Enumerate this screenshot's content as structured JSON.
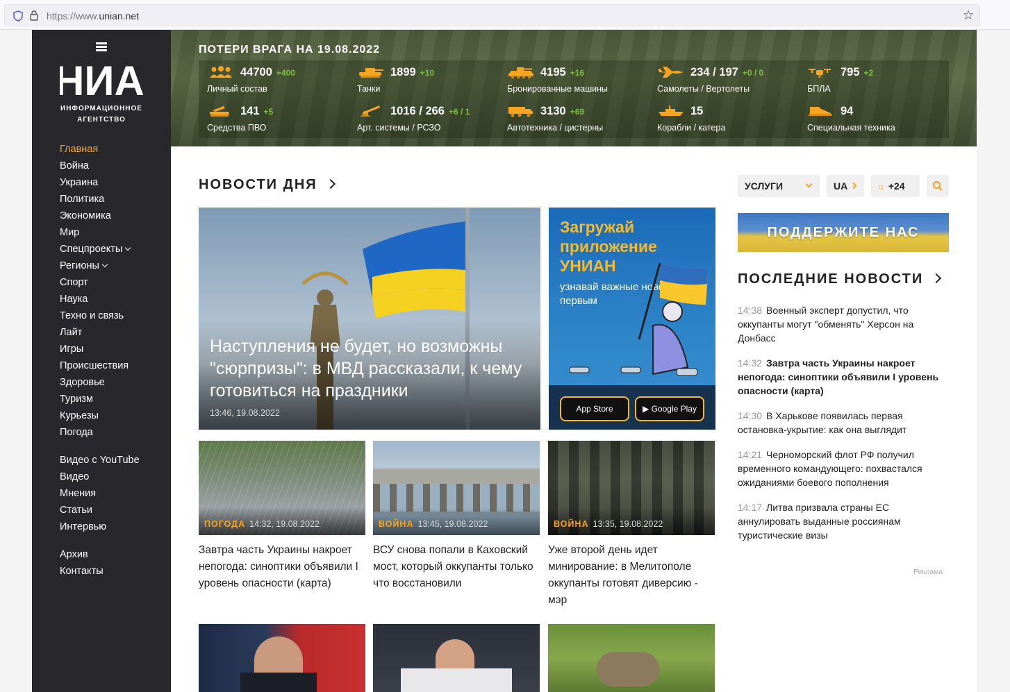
{
  "browser": {
    "url_prefix": "https://www.",
    "url_domain": "unian.net"
  },
  "logo": {
    "name": "УНИАН",
    "subtitle_1": "ИНФОРМАЦИОННОЕ",
    "subtitle_2": "АГЕНТСТВО"
  },
  "nav": {
    "main": [
      "Главная",
      "Война",
      "Украина",
      "Политика",
      "Экономика",
      "Мир",
      "Спецпроекты",
      "Регионы",
      "Спорт",
      "Наука",
      "Техно и связь",
      "Лайт",
      "Игры",
      "Происшествия",
      "Здоровье",
      "Туризм",
      "Курьезы",
      "Погода"
    ],
    "media": [
      "Видео с YouTube",
      "Видео",
      "Мнения",
      "Статьи",
      "Интервью"
    ],
    "other": [
      "Архив",
      "Контакты"
    ]
  },
  "losses": {
    "title": "ПОТЕРИ ВРАГА НА 19.08.2022",
    "items": [
      {
        "icon": "soldiers-icon",
        "value": "44700",
        "inc": "+400",
        "label": "Личный состав"
      },
      {
        "icon": "tank-icon",
        "value": "1899",
        "inc": "+10",
        "label": "Танки"
      },
      {
        "icon": "armored-vehicle-icon",
        "value": "4195",
        "inc": "+16",
        "label": "Бронированные машины"
      },
      {
        "icon": "plane-icon",
        "value": "234 / 197",
        "inc": "+0 / 0",
        "label": "Самолеты / Вертолеты"
      },
      {
        "icon": "drone-icon",
        "value": "795",
        "inc": "+2",
        "label": "БПЛА"
      },
      {
        "icon": "air-defense-icon",
        "value": "141",
        "inc": "+5",
        "label": "Средства ПВО"
      },
      {
        "icon": "artillery-icon",
        "value": "1016 / 266",
        "inc": "+6 / 1",
        "label": "Арт. системы / РСЗО"
      },
      {
        "icon": "truck-icon",
        "value": "3130",
        "inc": "+69",
        "label": "Автотехника / цистерны"
      },
      {
        "icon": "ship-icon",
        "value": "15",
        "inc": "",
        "label": "Корабли / катера"
      },
      {
        "icon": "special-equipment-icon",
        "value": "94",
        "inc": "",
        "label": "Специальная техника"
      }
    ]
  },
  "main": {
    "section_title": "НОВОСТИ ДНЯ",
    "hero": {
      "title": "Наступления не будет, но возможны \"сюрпризы\": в МВД рассказали, к чему готовиться на праздники",
      "date": "13:46, 19.08.2022"
    },
    "promo": {
      "title": "Загружай приложение УНИАН",
      "subtitle": "узнавай важные новости первым",
      "app_store": "App Store",
      "google_play": "Google Play"
    },
    "cards": [
      {
        "category": "ПОГОДА",
        "date": "14:32, 19.08.2022",
        "title": "Завтра часть Украины накроет непогода: синоптики объявили I уровень опасности (карта)"
      },
      {
        "category": "ВОЙНА",
        "date": "13:45, 19.08.2022",
        "title": "ВСУ снова попали в Каховский мост, который оккупанты только что восстановили"
      },
      {
        "category": "ВОЙНА",
        "date": "13:35, 19.08.2022",
        "title": "Уже второй день идет минирование: в Мелитополе оккупанты готовят диверсию - мэр"
      }
    ]
  },
  "right": {
    "services": "УСЛУГИ",
    "lang": "UA",
    "weather": "+24",
    "support": "ПОДДЕРЖИТЕ НАС",
    "latest_title": "ПОСЛЕДНИЕ НОВОСТИ",
    "latest": [
      {
        "time": "14:38",
        "text": "Военный эксперт допустил, что оккупанты могут \"обменять\" Херсон на Донбасс"
      },
      {
        "time": "14:32",
        "text": "Завтра часть Украины накроет непогода: синоптики объявили I уровень опасности (карта)"
      },
      {
        "time": "14:30",
        "text": "В Харькове появилась первая остановка-укрытие: как она выглядит"
      },
      {
        "time": "14:21",
        "text": "Черноморский флот РФ получил временного командующего: похвастался ожиданиями боевого пополнения"
      },
      {
        "time": "14:17",
        "text": "Литва призвала страны ЕС аннулировать выданные россиянам туристические визы"
      }
    ],
    "ad_label": "Реклама"
  },
  "colors": {
    "accent": "#f7a421",
    "sidebar": "#28282c",
    "increase": "#7fbf3c"
  }
}
